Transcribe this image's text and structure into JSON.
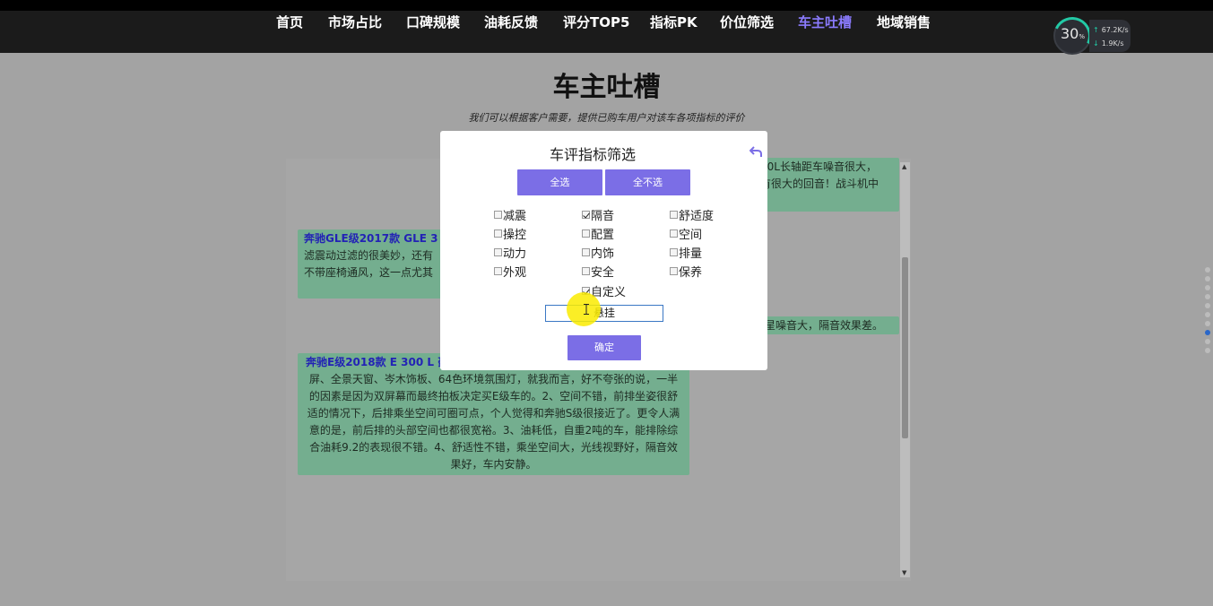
{
  "nav": {
    "items": [
      "首页",
      "市场占比",
      "口碑规模",
      "油耗反馈",
      "评分TOP5",
      "指标PK",
      "价位筛选",
      "车主吐槽",
      "地域销售"
    ],
    "active_index": 7,
    "active_color": "#8b7bff"
  },
  "speed_widget": {
    "percent": "30",
    "percent_unit": "%",
    "upload": "67.2",
    "upload_unit": "K/s",
    "download": "1.9",
    "download_unit": "K/s"
  },
  "page": {
    "title": "车主吐槽",
    "subtitle": "我们可以根据客户需要，提供已购车用户对该车各项指标的评价"
  },
  "reviews": [
    {
      "title": "奔驰GLE级2017款 GLE 3",
      "text": "滤震动过滤的很美妙，还有\n不带座椅通风，这一点尤其"
    },
    {
      "title": "奔驰E级2018款 E 300 L 豪",
      "text": "屏、全景天窗、岑木饰板、64色环境氛围灯，就我而言，好不夸张的说，一半的因素是因为双屏幕而最终拍板决定买E级车的。2、空间不错，前排坐姿很舒适的情况下，后排乘坐空间可圈可点，个人觉得和奔驰S级很接近了。更令人满意的是，前后排的头部空间也都很宽裕。3、油耗低，自重2吨的车，能排除综合油耗9.2的表现很不错。4、舒适性不错，乘坐空间大，光线视野好，隔音效果好，车内安静。"
    },
    {
      "text": "00L长轴距车噪音很大，\n有很大的回音！战斗机中"
    },
    {
      "text": "星噪音大，隔音效果差。"
    }
  ],
  "modal": {
    "title": "车评指标筛选",
    "select_all": "全选",
    "select_none": "全不选",
    "confirm": "确定",
    "options": [
      {
        "label": "减震",
        "checked": false
      },
      {
        "label": "隔音",
        "checked": true
      },
      {
        "label": "舒适度",
        "checked": false
      },
      {
        "label": "操控",
        "checked": false
      },
      {
        "label": "配置",
        "checked": false
      },
      {
        "label": "空间",
        "checked": false
      },
      {
        "label": "动力",
        "checked": false
      },
      {
        "label": "内饰",
        "checked": false
      },
      {
        "label": "排量",
        "checked": false
      },
      {
        "label": "外观",
        "checked": false
      },
      {
        "label": "安全",
        "checked": false
      },
      {
        "label": "保养",
        "checked": false
      },
      {
        "label": "自定义",
        "checked": true
      }
    ],
    "custom_value": "悬挂",
    "accent_color": "#7b6ee6"
  },
  "page_dots": {
    "count": 10,
    "active_index": 7
  }
}
